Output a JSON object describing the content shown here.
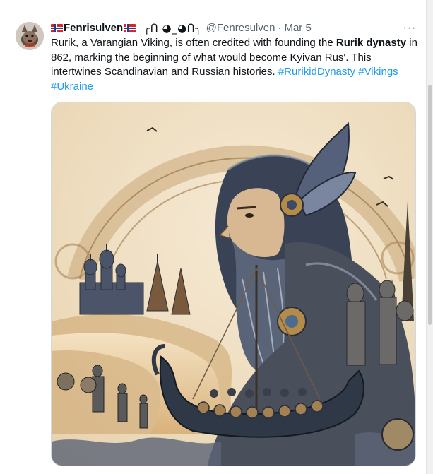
{
  "tweet": {
    "author": {
      "display_name": "Fenrisulven",
      "kaomoji": "╭ᑎ ◕_◕ᑎ╮",
      "handle": "@Fenresulven",
      "separator": "·",
      "date": "Mar 5"
    },
    "more_label": "···",
    "text_parts": {
      "t1": "Rurik, a Varangian Viking, is often credited with founding the ",
      "bold1": "Rurik dynasty",
      "t2": " in 862, marking the beginning of what would become Kyivan Rus'. This intertwines Scandinavian and Russian histories. ",
      "tag1": "#RurikidDynasty",
      "tag2": "#Vikings",
      "tag3": "#Ukraine"
    },
    "media": {
      "alt_subject": "illustration-rurik-viking"
    }
  },
  "colors": {
    "text": "#0f1419",
    "secondary": "#536471",
    "link": "#1d9bf0",
    "border": "#cfd9de",
    "flag_red": "#e0202f",
    "flag_blue": "#1f3e8c"
  },
  "icons": {
    "avatar": "wolf-avatar-icon",
    "flag": "norway-flag-icon",
    "more": "more-dots-icon"
  }
}
